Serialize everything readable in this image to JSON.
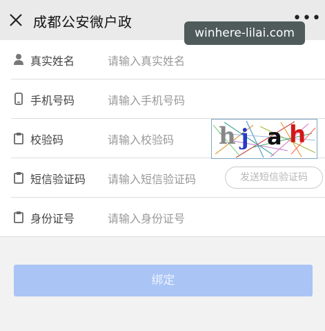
{
  "header": {
    "title": "成都公安微户政",
    "more_label": "•••"
  },
  "watermark": "winhere-lilai.com",
  "form": {
    "rows": [
      {
        "label": "真实姓名",
        "placeholder": "请输入真实姓名",
        "icon": "person-icon"
      },
      {
        "label": "手机号码",
        "placeholder": "请输入手机号码",
        "icon": "phone-icon"
      },
      {
        "label": "校验码",
        "placeholder": "请输入校验码",
        "icon": "clipboard-icon"
      },
      {
        "label": "短信验证码",
        "placeholder": "请输入短信验证码",
        "icon": "clipboard-icon"
      },
      {
        "label": "身份证号",
        "placeholder": "请输入身份证号",
        "icon": "clipboard-icon"
      }
    ],
    "captcha_text": [
      "h",
      "j",
      "a",
      "h"
    ],
    "sms_button_label": "发送短信验证码"
  },
  "submit_label": "绑定",
  "colors": {
    "submit_bg": "#a9c4f5",
    "captcha_border": "#7aa4c4"
  }
}
